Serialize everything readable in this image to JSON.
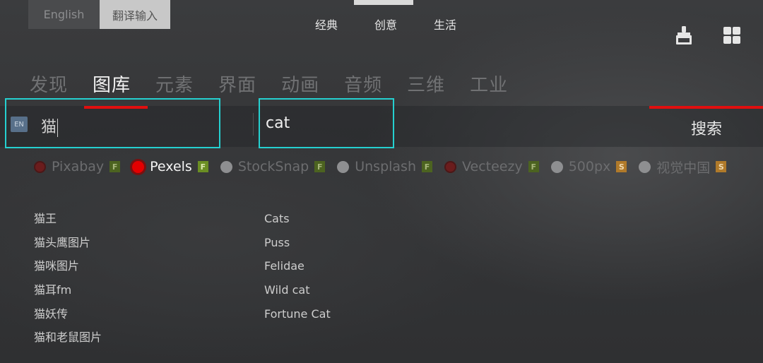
{
  "lang_switch": {
    "english": "English",
    "translate_input": "翻译输入"
  },
  "top_tabs": [
    "经典",
    "创意",
    "生活"
  ],
  "icons": {
    "left": "plugin-icon",
    "right": "grid-icon"
  },
  "category_tabs": [
    "发现",
    "图库",
    "元素",
    "界面",
    "动画",
    "音频",
    "三维",
    "工业"
  ],
  "search": {
    "lang_badge": "EN",
    "source_value": "猫",
    "translated_value": "cat",
    "button_label": "搜索"
  },
  "sources": [
    {
      "name": "Pixabay",
      "tag": "F"
    },
    {
      "name": "Pexels",
      "tag": "F"
    },
    {
      "name": "StockSnap",
      "tag": "F"
    },
    {
      "name": "Unsplash",
      "tag": "F"
    },
    {
      "name": "Vecteezy",
      "tag": "F"
    },
    {
      "name": "500px",
      "tag": "S"
    },
    {
      "name": "视觉中国",
      "tag": "S"
    }
  ],
  "suggestions_cn": [
    "猫王",
    "猫头鹰图片",
    "猫咪图片",
    "猫耳fm",
    "猫妖传",
    "猫和老鼠图片"
  ],
  "suggestions_en": [
    "Cats",
    "Puss",
    "Felidae",
    "Wild cat",
    "Fortune Cat"
  ]
}
